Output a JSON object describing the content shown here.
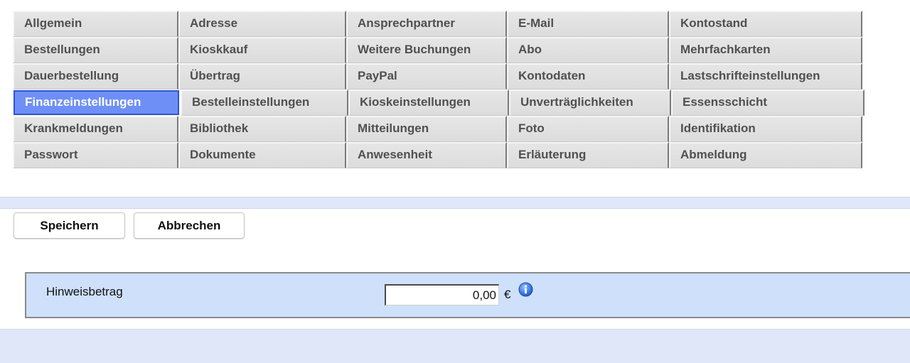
{
  "tabs": [
    [
      "Allgemein",
      "Adresse",
      "Ansprechpartner",
      "E-Mail",
      "Kontostand"
    ],
    [
      "Bestellungen",
      "Kioskkauf",
      "Weitere Buchungen",
      "Abo",
      "Mehrfachkarten"
    ],
    [
      "Dauerbestellung",
      "Übertrag",
      "PayPal",
      "Kontodaten",
      "Lastschrifteinstellungen"
    ],
    [
      "Finanzeinstellungen",
      "Bestelleinstellungen",
      "Kioskeinstellungen",
      "Unverträglichkeiten",
      "Essensschicht"
    ],
    [
      "Krankmeldungen",
      "Bibliothek",
      "Mitteilungen",
      "Foto",
      "Identifikation"
    ],
    [
      "Passwort",
      "Dokumente",
      "Anwesenheit",
      "Erläuterung",
      "Abmeldung"
    ]
  ],
  "active_tab": "Finanzeinstellungen",
  "buttons": {
    "save_label": "Speichern",
    "cancel_label": "Abbrechen"
  },
  "form": {
    "hint_amount_label": "Hinweisbetrag",
    "hint_amount_value": "0,00",
    "currency": "€",
    "info_icon": "info-circle-icon"
  },
  "colors": {
    "active_tab_bg": "#6e8ff5",
    "panel_bg": "#cfe0fb",
    "band_bg": "#dfe7f9"
  }
}
